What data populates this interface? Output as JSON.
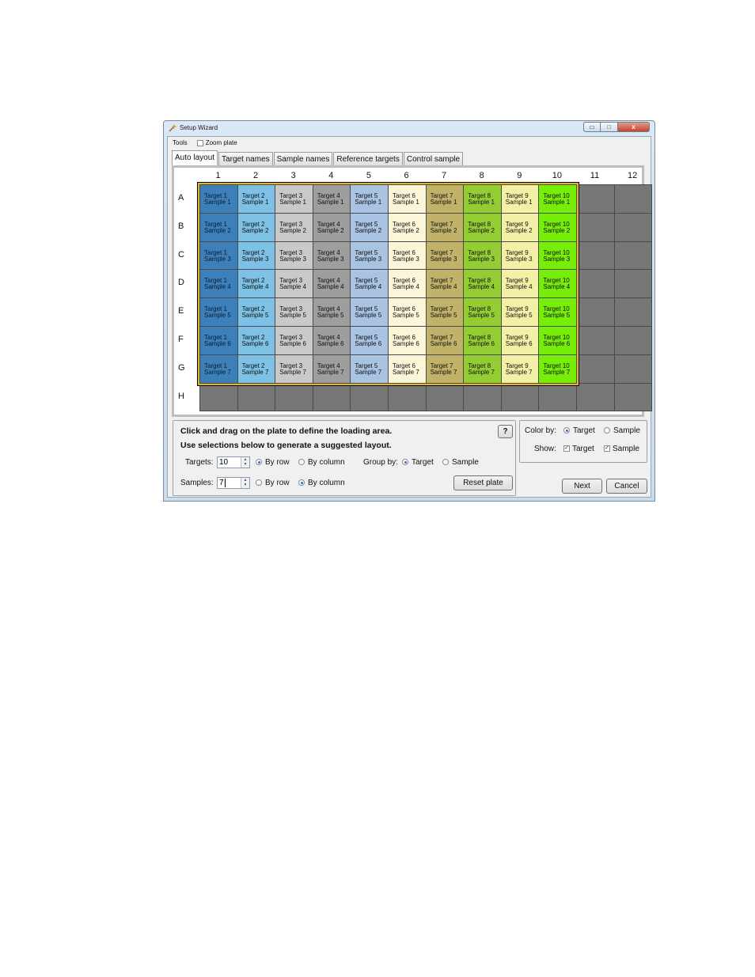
{
  "window": {
    "title": "Setup Wizard",
    "min_glyph": "▭",
    "max_glyph": "□",
    "close_glyph": "x"
  },
  "menu": {
    "tools": "Tools",
    "zoom_plate": "Zoom plate"
  },
  "tabs": [
    "Auto layout",
    "Target names",
    "Sample names",
    "Reference targets",
    "Control sample"
  ],
  "plate": {
    "columns": [
      "1",
      "2",
      "3",
      "4",
      "5",
      "6",
      "7",
      "8",
      "9",
      "10",
      "11",
      "12"
    ],
    "rows": [
      "A",
      "B",
      "C",
      "D",
      "E",
      "F",
      "G",
      "H"
    ],
    "assigned_columns": 10,
    "assigned_rows": 7,
    "empty_well_color": "#777777",
    "selection_color": "#e0b820",
    "target_colors": [
      "#3d7fb8",
      "#7ec1e6",
      "#c9c9c9",
      "#9e9e9e",
      "#a9c3e3",
      "#fbf6d9",
      "#c1b26a",
      "#93cc33",
      "#f3efa6",
      "#76ee0a"
    ],
    "wells": [
      [
        "Target 1",
        "Target 2",
        "Target 3",
        "Target 4",
        "Target 5",
        "Target 6",
        "Target 7",
        "Target 8",
        "Target 9",
        "Target 10"
      ],
      [
        "Sample 1",
        "Sample 2",
        "Sample 3",
        "Sample 4",
        "Sample 5",
        "Sample 6",
        "Sample 7"
      ]
    ]
  },
  "instructions": {
    "line1": "Click and drag on the plate to define the loading area.",
    "line2": "Use selections below to generate a suggested layout."
  },
  "targets": {
    "label": "Targets:",
    "value": "10",
    "by_row": "By row",
    "by_column": "By column",
    "selected": "By row"
  },
  "samples": {
    "label": "Samples:",
    "value": "7",
    "by_row": "By row",
    "by_column": "By column",
    "selected": "By column"
  },
  "group_by": {
    "label": "Group by:",
    "target": "Target",
    "sample": "Sample",
    "selected": "Target"
  },
  "help_button": "?",
  "reset_button": "Reset plate",
  "color_by": {
    "label": "Color by:",
    "target": "Target",
    "sample": "Sample",
    "selected": "Target"
  },
  "show": {
    "label": "Show:",
    "target": "Target",
    "sample": "Sample",
    "target_checked": true,
    "sample_checked": true
  },
  "next_button": "Next",
  "cancel_button": "Cancel"
}
